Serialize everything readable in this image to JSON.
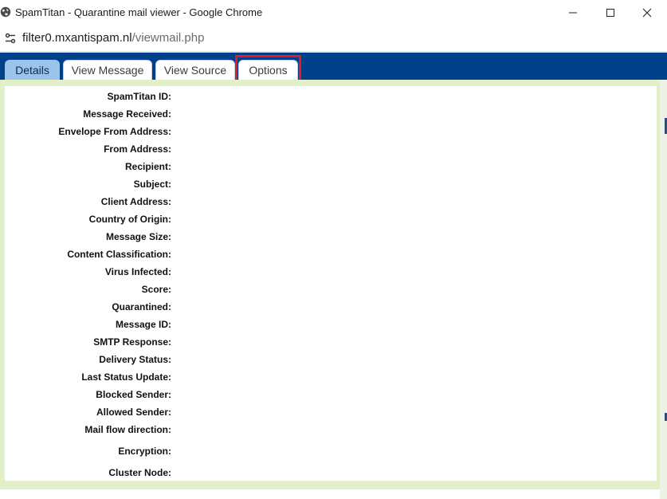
{
  "window": {
    "title": "SpamTitan - Quarantine mail viewer - Google Chrome"
  },
  "address_bar": {
    "url_host": "filter0.mxantispam.nl",
    "url_path": "/viewmail.php"
  },
  "tabs": [
    {
      "label": "Details",
      "active": true
    },
    {
      "label": "View Message",
      "active": false
    },
    {
      "label": "View Source",
      "active": false
    },
    {
      "label": "Options",
      "active": false,
      "highlighted": true
    }
  ],
  "fields": [
    {
      "label": "SpamTitan ID:"
    },
    {
      "label": "Message Received:"
    },
    {
      "label": "Envelope From Address:"
    },
    {
      "label": "From Address:"
    },
    {
      "label": "Recipient:"
    },
    {
      "label": "Subject:"
    },
    {
      "label": "Client Address:"
    },
    {
      "label": "Country of Origin:"
    },
    {
      "label": "Message Size:"
    },
    {
      "label": "Content Classification:"
    },
    {
      "label": "Virus Infected:"
    },
    {
      "label": "Score:"
    },
    {
      "label": "Quarantined:"
    },
    {
      "label": "Message ID:"
    },
    {
      "label": "SMTP Response:"
    },
    {
      "label": "Delivery Status:"
    },
    {
      "label": "Last Status Update:"
    },
    {
      "label": "Blocked Sender:"
    },
    {
      "label": "Allowed Sender:"
    },
    {
      "label": "Mail flow direction:"
    },
    {
      "label": "Encryption:"
    },
    {
      "label": "Cluster Node:"
    }
  ],
  "colors": {
    "tabbar": "#003f8a",
    "active_tab": "#9ac4ec",
    "frame": "#e3efc8",
    "highlight": "#e01b24"
  },
  "icons": {
    "app": "globe-icon",
    "site_info": "tune-icon",
    "minimize": "minimize-icon",
    "maximize": "maximize-icon",
    "close": "close-icon"
  }
}
